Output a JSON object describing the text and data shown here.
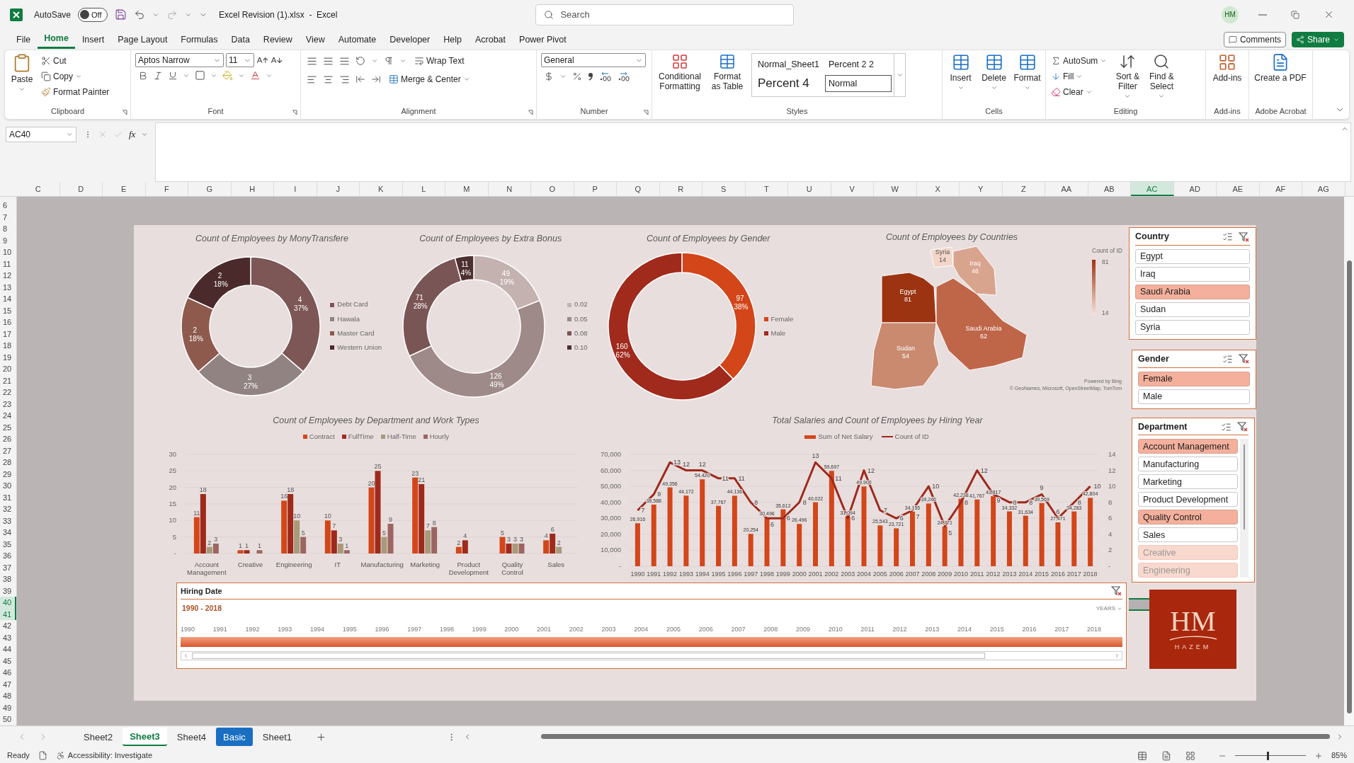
{
  "title_bar": {
    "autosave_label": "AutoSave",
    "autosave": {
      "on": false,
      "label": "Off"
    },
    "file_title": "Excel Revision (1).xlsx  -  Excel",
    "search": {
      "placeholder": "Search"
    },
    "avatar": "HM"
  },
  "menu_tabs": [
    {
      "label": "File",
      "selected": false
    },
    {
      "label": "Home",
      "selected": true
    },
    {
      "label": "Insert",
      "selected": false
    },
    {
      "label": "Page Layout",
      "selected": false
    },
    {
      "label": "Formulas",
      "selected": false
    },
    {
      "label": "Data",
      "selected": false
    },
    {
      "label": "Review",
      "selected": false
    },
    {
      "label": "View",
      "selected": false
    },
    {
      "label": "Automate",
      "selected": false
    },
    {
      "label": "Developer",
      "selected": false
    },
    {
      "label": "Help",
      "selected": false
    },
    {
      "label": "Acrobat",
      "selected": false
    },
    {
      "label": "Power Pivot",
      "selected": false
    }
  ],
  "menu_buttons": {
    "comments": "Comments",
    "share": "Share"
  },
  "ribbon": {
    "clipboard": {
      "title": "Clipboard",
      "paste": "Paste",
      "cut": "Cut",
      "copy": "Copy",
      "format_painter": "Format Painter"
    },
    "font": {
      "title": "Font",
      "font_name": "Aptos Narrow",
      "font_size": "11"
    },
    "alignment": {
      "title": "Alignment",
      "wrap_text": "Wrap Text",
      "merge": "Merge & Center"
    },
    "number": {
      "title": "Number",
      "format": "General"
    },
    "styles": {
      "title": "Styles",
      "conditional": "Conditional Formatting",
      "format_table": "Format as Table",
      "gallery": [
        {
          "label": "Normal_Sheet1",
          "selected": false
        },
        {
          "label": "Percent 2 2",
          "selected": false
        },
        {
          "label": "Percent 4",
          "selected": false
        },
        {
          "label": "Normal",
          "selected": true
        }
      ]
    },
    "cells": {
      "title": "Cells",
      "buttons": [
        "Insert",
        "Delete",
        "Format"
      ]
    },
    "editing": {
      "title": "Editing",
      "autosum": "AutoSum",
      "fill": "Fill",
      "clear": "Clear",
      "sort": "Sort & Filter",
      "find": "Find & Select"
    },
    "addins": {
      "title": "Add-ins",
      "button": "Add-ins"
    },
    "acrobat": {
      "title": "Adobe Acrobat",
      "button": "Create a PDF"
    }
  },
  "formula_bar": {
    "name_box": "AC40",
    "fx": "fx"
  },
  "grid": {
    "columns": [
      {
        "label": "C",
        "selected": false
      },
      {
        "label": "D",
        "selected": false
      },
      {
        "label": "E",
        "selected": false
      },
      {
        "label": "F",
        "selected": false
      },
      {
        "label": "G",
        "selected": false
      },
      {
        "label": "H",
        "selected": false
      },
      {
        "label": "I",
        "selected": false
      },
      {
        "label": "J",
        "selected": false
      },
      {
        "label": "K",
        "selected": false
      },
      {
        "label": "L",
        "selected": false
      },
      {
        "label": "M",
        "selected": false
      },
      {
        "label": "N",
        "selected": false
      },
      {
        "label": "O",
        "selected": false
      },
      {
        "label": "P",
        "selected": false
      },
      {
        "label": "Q",
        "selected": false
      },
      {
        "label": "R",
        "selected": false
      },
      {
        "label": "S",
        "selected": false
      },
      {
        "label": "T",
        "selected": false
      },
      {
        "label": "U",
        "selected": false
      },
      {
        "label": "V",
        "selected": false
      },
      {
        "label": "W",
        "selected": false
      },
      {
        "label": "X",
        "selected": false
      },
      {
        "label": "Y",
        "selected": false
      },
      {
        "label": "Z",
        "selected": false
      },
      {
        "label": "AA",
        "selected": false
      },
      {
        "label": "AB",
        "selected": false
      },
      {
        "label": "AC",
        "selected": true
      },
      {
        "label": "AD",
        "selected": false
      },
      {
        "label": "AE",
        "selected": false
      },
      {
        "label": "AF",
        "selected": false
      },
      {
        "label": "AG",
        "selected": false
      }
    ],
    "rows": [
      {
        "label": "6",
        "selected": false
      },
      {
        "label": "7",
        "selected": false
      },
      {
        "label": "8",
        "selected": false
      },
      {
        "label": "9",
        "selected": false
      },
      {
        "label": "10",
        "selected": false
      },
      {
        "label": "11",
        "selected": false
      },
      {
        "label": "12",
        "selected": false
      },
      {
        "label": "13",
        "selected": false
      },
      {
        "label": "14",
        "selected": false
      },
      {
        "label": "15",
        "selected": false
      },
      {
        "label": "16",
        "selected": false
      },
      {
        "label": "17",
        "selected": false
      },
      {
        "label": "18",
        "selected": false
      },
      {
        "label": "19",
        "selected": false
      },
      {
        "label": "20",
        "selected": false
      },
      {
        "label": "21",
        "selected": false
      },
      {
        "label": "22",
        "selected": false
      },
      {
        "label": "23",
        "selected": false
      },
      {
        "label": "24",
        "selected": false
      },
      {
        "label": "25",
        "selected": false
      },
      {
        "label": "26",
        "selected": false
      },
      {
        "label": "27",
        "selected": false
      },
      {
        "label": "28",
        "selected": false
      },
      {
        "label": "29",
        "selected": false
      },
      {
        "label": "30",
        "selected": false
      },
      {
        "label": "31",
        "selected": false
      },
      {
        "label": "32",
        "selected": false
      },
      {
        "label": "33",
        "selected": false
      },
      {
        "label": "34",
        "selected": false
      },
      {
        "label": "35",
        "selected": false
      },
      {
        "label": "36",
        "selected": false
      },
      {
        "label": "37",
        "selected": false
      },
      {
        "label": "38",
        "selected": false
      },
      {
        "label": "39",
        "selected": false
      },
      {
        "label": "40",
        "selected": true
      },
      {
        "label": "41",
        "selected": true
      },
      {
        "label": "42",
        "selected": false
      },
      {
        "label": "43",
        "selected": false
      },
      {
        "label": "44",
        "selected": false
      },
      {
        "label": "45",
        "selected": false
      },
      {
        "label": "46",
        "selected": false
      },
      {
        "label": "47",
        "selected": false
      },
      {
        "label": "48",
        "selected": false
      },
      {
        "label": "49",
        "selected": false
      },
      {
        "label": "50",
        "selected": false
      }
    ]
  },
  "donuts": [
    {
      "title": "Count of Employees by MonyTransfere",
      "slices": [
        {
          "color": "#7d5656"
        },
        {
          "color": "#928383"
        },
        {
          "color": "#8e5a4e"
        },
        {
          "color": "#4a2a2a"
        }
      ],
      "chart_data": {
        "type": "donut",
        "categories": [
          "Debt Card",
          "Hawala",
          "Master Card",
          "Western Union"
        ],
        "values": [
          4,
          3,
          2,
          2
        ],
        "value_labels": [
          "4 37%",
          "3 27%",
          "2 18%",
          "2 18%"
        ],
        "data_labels": true,
        "legend": "right"
      }
    },
    {
      "title": "Count of Employees by Extra Bonus",
      "slices": [
        {
          "color": "#c4b2b0"
        },
        {
          "color": "#9e8a88"
        },
        {
          "color": "#7a5555"
        },
        {
          "color": "#4d2f2f"
        }
      ],
      "chart_data": {
        "type": "donut",
        "categories": [
          "0.02",
          "0.05",
          "0.08",
          "0.10"
        ],
        "values": [
          49,
          126,
          71,
          11
        ],
        "value_labels": [
          "49 19%",
          "126 49%",
          "71 28%",
          "11 4%"
        ],
        "data_labels": true,
        "legend": "right"
      }
    },
    {
      "title": "Count of Employees by Gender",
      "slices": [
        {
          "color": "#d2461a"
        },
        {
          "color": "#a02a1c"
        }
      ],
      "chart_data": {
        "type": "donut",
        "categories": [
          "Female",
          "Male"
        ],
        "values": [
          97,
          160
        ],
        "value_labels": [
          "97 38%",
          "160 62%"
        ],
        "data_labels": true,
        "legend": "right"
      }
    }
  ],
  "map": {
    "title": "Count of Employees by Countries",
    "legend_title": "Count of ID",
    "legend_max": "81",
    "legend_min": "14",
    "regions": [
      {
        "name": "Syria",
        "value": "14",
        "color": "#f3d6c8"
      },
      {
        "name": "Iraq",
        "value": "46",
        "color": "#d9a48e"
      },
      {
        "name": "Egypt",
        "value": "81",
        "color": "#9c3412"
      },
      {
        "name": "Saudi Arabia",
        "value": "62",
        "color": "#bf6649"
      },
      {
        "name": "Sudan",
        "value": "54",
        "color": "#c98a70"
      }
    ],
    "powered": "Powered by Bing",
    "credits": "© GeoNames, Microsoft, OpenStreetMap, TomTom"
  },
  "dept_chart": {
    "title": "Count of Employees by Department and Work Types",
    "chart_data": {
      "type": "bar",
      "categories": [
        "Account Management",
        "Creative",
        "Engineering",
        "IT",
        "Manufacturing",
        "Marketing",
        "Product Development",
        "Quality Control",
        "Sales"
      ],
      "series": [
        {
          "name": "Contract",
          "color": "#d2461a",
          "values": [
            11,
            1,
            16,
            10,
            20,
            23,
            2,
            5,
            4
          ]
        },
        {
          "name": "FullTime",
          "color": "#9e2a1c",
          "values": [
            18,
            1,
            18,
            7,
            25,
            21,
            4,
            3,
            6
          ]
        },
        {
          "name": "Half-Time",
          "color": "#a89a7a",
          "values": [
            2,
            null,
            10,
            3,
            5,
            7,
            null,
            3,
            2
          ]
        },
        {
          "name": "Hourly",
          "color": "#9c6660",
          "values": [
            3,
            1,
            5,
            1,
            9,
            8,
            null,
            3,
            null
          ]
        }
      ],
      "ylim": [
        0,
        30
      ],
      "yticks": [
        {
          "value": 0,
          "label": "-"
        },
        5,
        10,
        15,
        20,
        25,
        30
      ],
      "data_labels": true,
      "grid": true,
      "legend": "top"
    }
  },
  "salary_chart": {
    "title": "Total Salaries and Count of Employees by Hiring Year",
    "chart_data": {
      "type": "bar",
      "categories": [
        "1990",
        "1991",
        "1992",
        "1993",
        "1994",
        "1995",
        "1996",
        "1997",
        "1998",
        "1999",
        "2000",
        "2001",
        "2002",
        "2003",
        "2004",
        "2005",
        "2006",
        "2007",
        "2008",
        "2009",
        "2010",
        "2011",
        "2012",
        "2013",
        "2014",
        "2015",
        "2016",
        "2017",
        "2018"
      ],
      "series": [
        {
          "name": "Sum of Net Salary",
          "type": "bar",
          "color": "#d2461a",
          "values": [
            26916,
            38588,
            49356,
            44172,
            54420,
            37767,
            44136,
            20254,
            30496,
            35612,
            26496,
            40022,
            59697,
            31094,
            49900,
            25543,
            23721,
            34155,
            39246,
            24771,
            42238,
            41767,
            43817,
            34332,
            31634,
            39569,
            27471,
            34283,
            42804
          ],
          "value_labels": [
            "26,916",
            "38,588",
            "49,356",
            "44,172",
            "54,420",
            "37,767",
            "44,136",
            "20,254",
            "30,496",
            "35,612",
            "26,496",
            "40,022",
            "59,697",
            "31,094",
            "49,900",
            "25,543",
            "23,721",
            "34,155",
            "39,246",
            "24,771",
            "42,238",
            "41,767",
            "43,817",
            "34,332",
            "31,634",
            "39,569",
            "27,471",
            "34,283",
            "42,804"
          ]
        },
        {
          "name": "Count of ID",
          "type": "line",
          "axis": "y2",
          "color": "#9e2a1c",
          "values": [
            7,
            9,
            13,
            12,
            12,
            11,
            11,
            8,
            6,
            6,
            8,
            13,
            11,
            6,
            12,
            7,
            6,
            7,
            10,
            5,
            8,
            12,
            9,
            8,
            8,
            9,
            6,
            8,
            10
          ],
          "value_labels": [
            "7",
            "9",
            "13",
            "12",
            "12",
            "11",
            "11",
            "8",
            "6",
            "6",
            "8",
            "13",
            "11",
            "6",
            "12",
            "7",
            "6",
            "7",
            "10",
            "5",
            "8",
            "12",
            "9",
            "8",
            "8",
            "9",
            "6",
            "8",
            "10"
          ]
        }
      ],
      "ylim": [
        0,
        70000
      ],
      "yticks": [
        {
          "value": 0,
          "label": "-"
        },
        {
          "value": 10000,
          "label": "10,000"
        },
        {
          "value": 20000,
          "label": "20,000"
        },
        {
          "value": 30000,
          "label": "30,000"
        },
        {
          "value": 40000,
          "label": "40,000"
        },
        {
          "value": 50000,
          "label": "50,000"
        },
        {
          "value": 60000,
          "label": "60,000"
        },
        {
          "value": 70000,
          "label": "70,000"
        }
      ],
      "y2lim": [
        0,
        14
      ],
      "y2ticks": [
        {
          "value": 0,
          "label": "-"
        },
        2,
        4,
        6,
        8,
        10,
        12,
        14
      ],
      "data_labels": true,
      "grid": true,
      "legend": "top"
    }
  },
  "timeline": {
    "title": "Hiring Date",
    "range": "1990 - 2018",
    "unit": "YEARS",
    "level": 1,
    "years": [
      "1990",
      "1991",
      "1992",
      "1993",
      "1994",
      "1995",
      "1996",
      "1997",
      "1998",
      "1999",
      "2000",
      "2001",
      "2002",
      "2003",
      "2004",
      "2005",
      "2006",
      "2007",
      "2008",
      "2009",
      "2010",
      "2011",
      "2012",
      "2013",
      "2014",
      "2015",
      "2016",
      "2017",
      "2018"
    ]
  },
  "slicers": [
    {
      "title": "Country",
      "items": [
        {
          "label": "Egypt",
          "selected": false
        },
        {
          "label": "Iraq",
          "selected": false
        },
        {
          "label": "Saudi Arabia",
          "selected": true
        },
        {
          "label": "Sudan",
          "selected": false
        },
        {
          "label": "Syria",
          "selected": false
        }
      ]
    },
    {
      "title": "Gender",
      "items": [
        {
          "label": "Female",
          "selected": true
        },
        {
          "label": "Male",
          "selected": false
        }
      ]
    },
    {
      "title": "Department",
      "scroll": true,
      "items": [
        {
          "label": "Account Management",
          "selected": true,
          "has_data": true
        },
        {
          "label": "Manufacturing",
          "selected": false,
          "has_data": true
        },
        {
          "label": "Marketing",
          "selected": false,
          "has_data": true
        },
        {
          "label": "Product Development",
          "selected": false,
          "has_data": true
        },
        {
          "label": "Quality Control",
          "selected": true,
          "has_data": true
        },
        {
          "label": "Sales",
          "selected": false,
          "has_data": true
        },
        {
          "label": "Creative",
          "selected": false,
          "has_data": false
        },
        {
          "label": "Engineering",
          "selected": false,
          "has_data": false
        }
      ]
    }
  ],
  "logo": {
    "initials": "HM",
    "name": "HAZEM"
  },
  "sheet_tabs": [
    {
      "label": "Sheet2",
      "selected": false
    },
    {
      "label": "Sheet3",
      "selected": true
    },
    {
      "label": "Sheet4",
      "selected": false
    },
    {
      "label": "Basic",
      "selected": false,
      "color": "#1a6fc2"
    },
    {
      "label": "Sheet1",
      "selected": false
    }
  ],
  "status_bar": {
    "ready": "Ready",
    "accessibility": "Accessibility: Investigate",
    "zoom": {
      "level": 0.45,
      "reading": "85%"
    }
  }
}
